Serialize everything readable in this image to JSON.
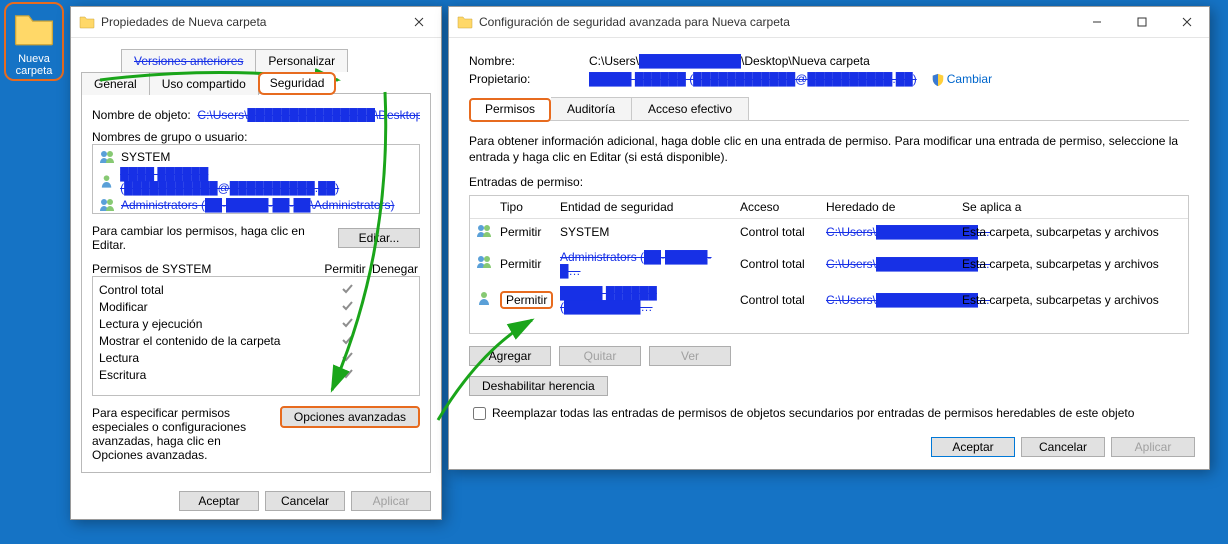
{
  "desktop": {
    "folder_label": "Nueva carpeta"
  },
  "propsWindow": {
    "title": "Propiedades de Nueva carpeta",
    "tabs": {
      "prev_versions": "Versiones anteriores",
      "customize": "Personalizar",
      "general": "General",
      "sharing": "Uso compartido",
      "security": "Seguridad"
    },
    "object_name_label": "Nombre de objeto:",
    "object_name_value": "C:\\Users\\███████████████\\Desktop\\Nueva carp",
    "groups_label": "Nombres de grupo o usuario:",
    "groups": {
      "system": "SYSTEM",
      "user1": "████ ██████ (███████████@██████████.██)",
      "user2": "Administrators (██-█████-██-██\\Administrators)"
    },
    "edit_hint": "Para cambiar los permisos, haga clic en Editar.",
    "edit_btn": "Editar...",
    "perm_for_label": "Permisos de SYSTEM",
    "allow_label": "Permitir",
    "deny_label": "Denegar",
    "perms": {
      "full": "Control total",
      "modify": "Modificar",
      "readexec": "Lectura y ejecución",
      "listfolder": "Mostrar el contenido de la carpeta",
      "read": "Lectura",
      "write": "Escritura"
    },
    "adv_hint": "Para especificar permisos especiales o configuraciones avanzadas, haga clic en Opciones avanzadas.",
    "adv_btn": "Opciones avanzadas",
    "ok": "Aceptar",
    "cancel": "Cancelar",
    "apply": "Aplicar"
  },
  "advWindow": {
    "title": "Configuración de seguridad avanzada para Nueva carpeta",
    "name_label": "Nombre:",
    "name_value": "C:\\Users\\████████████\\Desktop\\Nueva carpeta",
    "owner_label": "Propietario:",
    "owner_value": "█████ ██████ (████████████@██████████.██)",
    "change_link": "Cambiar",
    "tabs": {
      "permissions": "Permisos",
      "auditing": "Auditoría",
      "effective": "Acceso efectivo"
    },
    "info_text": "Para obtener información adicional, haga doble clic en una entrada de permiso. Para modificar una entrada de permiso, seleccione la entrada y haga clic en Editar (si está disponible).",
    "entries_label": "Entradas de permiso:",
    "headers": {
      "type": "Tipo",
      "principal": "Entidad de seguridad",
      "access": "Acceso",
      "inherited": "Heredado de",
      "applies": "Se aplica a"
    },
    "rows": {
      "r1": {
        "type": "Permitir",
        "principal": "SYSTEM",
        "access": "Control total",
        "inherited": "C:\\Users\\████████████…",
        "applies": "Esta carpeta, subcarpetas y archivos"
      },
      "r2": {
        "type": "Permitir",
        "principal": "Administrators (██-█████-█…",
        "access": "Control total",
        "inherited": "C:\\Users\\████████████…",
        "applies": "Esta carpeta, subcarpetas y archivos"
      },
      "r3": {
        "type": "Permitir",
        "principal": "█████ ██████ (█████████…",
        "access": "Control total",
        "inherited": "C:\\Users\\████████████…",
        "applies": "Esta carpeta, subcarpetas y archivos"
      }
    },
    "add_btn": "Agregar",
    "remove_btn": "Quitar",
    "view_btn": "Ver",
    "disable_inherit_btn": "Deshabilitar herencia",
    "replace_chk": "Reemplazar todas las entradas de permisos de objetos secundarios por entradas de permisos heredables de este objeto",
    "ok": "Aceptar",
    "cancel": "Cancelar",
    "apply": "Aplicar"
  }
}
